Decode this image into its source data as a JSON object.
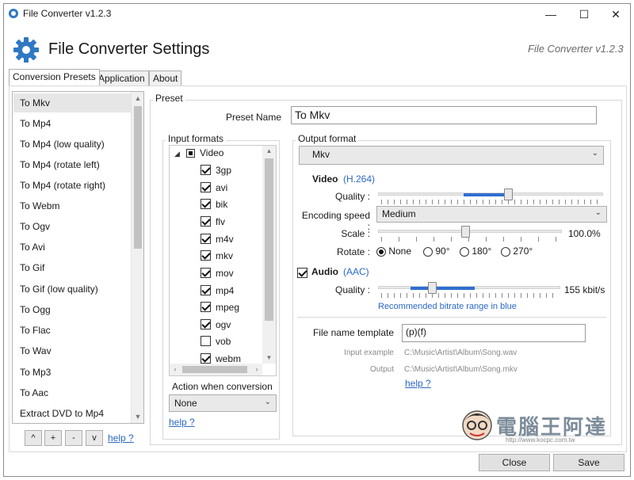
{
  "window": {
    "title": "File Converter v1.2.3"
  },
  "header": {
    "title": "File Converter Settings",
    "version": "File Converter v1.2.3"
  },
  "tabs": [
    {
      "label": "Conversion Presets",
      "active": true
    },
    {
      "label": "Application",
      "active": false
    },
    {
      "label": "About",
      "active": false
    }
  ],
  "presets": [
    "To Mkv",
    "To Mp4",
    "To Mp4 (low quality)",
    "To Mp4 (rotate left)",
    "To Mp4 (rotate right)",
    "To Webm",
    "To Ogv",
    "To Avi",
    "To Gif",
    "To Gif (low quality)",
    "To Ogg",
    "To Flac",
    "To Wav",
    "To Mp3",
    "To Aac",
    "Extract DVD to Mp4"
  ],
  "preset_buttons": {
    "up": "^",
    "add": "+",
    "remove": "-",
    "down": "v",
    "help": "help ?"
  },
  "preset": {
    "group_label": "Preset",
    "name_label": "Preset Name",
    "name_value": "To Mkv"
  },
  "input_formats": {
    "label": "Input formats",
    "category": "Video",
    "formats": [
      {
        "name": "3gp",
        "checked": true
      },
      {
        "name": "avi",
        "checked": true
      },
      {
        "name": "bik",
        "checked": true
      },
      {
        "name": "flv",
        "checked": true
      },
      {
        "name": "m4v",
        "checked": true
      },
      {
        "name": "mkv",
        "checked": true
      },
      {
        "name": "mov",
        "checked": true
      },
      {
        "name": "mp4",
        "checked": true
      },
      {
        "name": "mpeg",
        "checked": true
      },
      {
        "name": "ogv",
        "checked": true
      },
      {
        "name": "vob",
        "checked": false
      },
      {
        "name": "webm",
        "checked": true
      }
    ],
    "action_label": "Action when conversion s",
    "action_value": "None",
    "help": "help ?"
  },
  "output": {
    "label": "Output format",
    "format_value": "Mkv",
    "video_label": "Video",
    "video_codec": "(H.264)",
    "quality_label": "Quality :",
    "video_quality": 0.58,
    "video_recommended_range": [
      0.38,
      0.6
    ],
    "encoding_speed_label": "Encoding speed :",
    "encoding_speed_value": "Medium",
    "scale_label": "Scale :",
    "scale_value": "100.0%",
    "scale_level": 0.48,
    "rotate_label": "Rotate :",
    "rotate_options": [
      "None",
      "90°",
      "180°",
      "270°"
    ],
    "rotate_selected": "None",
    "audio_label": "Audio",
    "audio_codec": "(AAC)",
    "audio_checked": true,
    "audio_quality_label": "Quality :",
    "audio_quality_value": "155 kbit/s",
    "audio_quality": 0.3,
    "audio_recommended_range": [
      0.18,
      0.53
    ],
    "recommended_note": "Recommended bitrate range in blue",
    "template_label": "File name template",
    "template_value": "(p)(f)",
    "input_example_label": "Input example",
    "input_example_value": "C:\\Music\\Artist\\Album\\Song.wav",
    "output_label": "Output",
    "output_value": "C:\\Music\\Artist\\Album\\Song.mkv",
    "help": "help ?"
  },
  "footer": {
    "close": "Close",
    "save": "Save"
  },
  "watermark": {
    "name": "電腦王阿達",
    "url": "http://www.kocpc.com.tw"
  },
  "colors": {
    "accent": "#2f6fd0",
    "link": "#2b69c6",
    "gear": "#2f78c4"
  }
}
